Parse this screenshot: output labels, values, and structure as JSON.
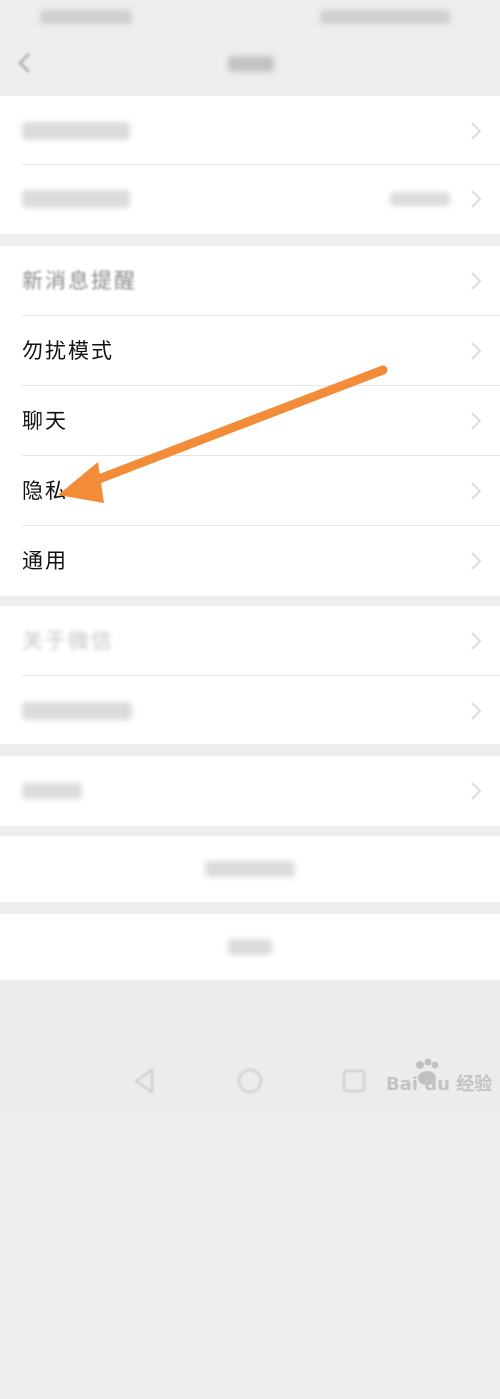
{
  "settings_items": [
    {
      "label": "新消息提醒"
    },
    {
      "label": "勿扰模式"
    },
    {
      "label": "聊天"
    },
    {
      "label": "隐私"
    },
    {
      "label": "通用"
    },
    {
      "label": "关于微信"
    }
  ],
  "colors": {
    "arrow": "#f28c38",
    "background": "#ededed",
    "card": "#ffffff",
    "text": "#111111"
  },
  "icons": {
    "back": "chevron-left-icon",
    "row": "chevron-right-icon",
    "annotation": "arrow-annotation-icon",
    "watermark": "baidu-jingyan-logo"
  },
  "watermark": {
    "text": "Bai du 经验"
  }
}
